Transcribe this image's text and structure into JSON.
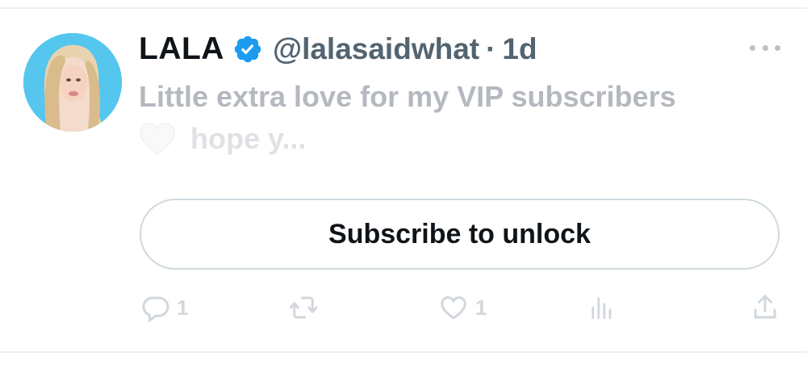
{
  "tweet": {
    "display_name": "LALA",
    "handle": "@lalasaidwhat",
    "separator": "·",
    "time": "1d",
    "text_line1": "Little extra love for my VIP subscribers",
    "text_line2": "hope y...",
    "emoji": "white-heart",
    "verified": true
  },
  "subscribe": {
    "label": "Subscribe to unlock"
  },
  "actions": {
    "reply_count": "1",
    "like_count": "1"
  },
  "colors": {
    "verified_badge": "#1d9bf0",
    "avatar_background": "#55c6ee",
    "muted_text": "#536471",
    "faded_text": "#b4b9bf"
  }
}
